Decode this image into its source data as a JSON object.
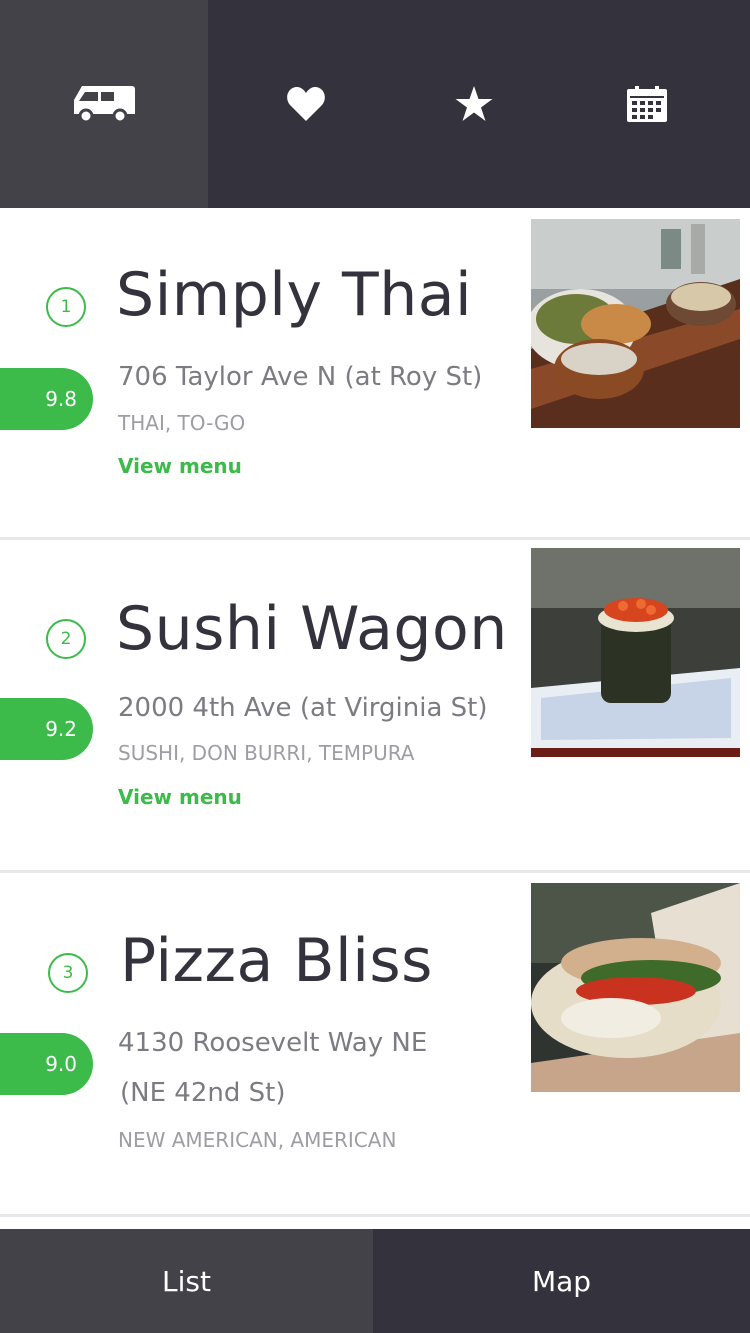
{
  "nav": {
    "tabs": [
      {
        "icon": "truck-icon",
        "active": true
      },
      {
        "icon": "heart-icon",
        "active": false
      },
      {
        "icon": "star-icon",
        "active": false
      },
      {
        "icon": "calendar-icon",
        "active": false
      }
    ]
  },
  "restaurants": [
    {
      "rank": "1",
      "name": "Simply Thai",
      "score": "9.8",
      "address": "706 Taylor Ave N (at Roy St)",
      "cuisine": "THAI, TO-GO",
      "menu_label": "View menu"
    },
    {
      "rank": "2",
      "name": "Sushi Wagon",
      "score": "9.2",
      "address": "2000 4th Ave (at Virginia St)",
      "cuisine": "SUSHI, DON BURRI, TEMPURA",
      "menu_label": "View menu"
    },
    {
      "rank": "3",
      "name": "Pizza Bliss",
      "score": "9.0",
      "address_line1": "4130 Roosevelt Way NE",
      "address_line2": "(NE 42nd St)",
      "cuisine": "NEW AMERICAN, AMERICAN"
    }
  ],
  "bottom_nav": {
    "list_label": "List",
    "map_label": "Map"
  },
  "colors": {
    "nav_bg": "#33323d",
    "nav_active": "#434249",
    "accent": "#3dbb4a",
    "text": "#33323d"
  }
}
